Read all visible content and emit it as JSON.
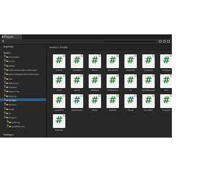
{
  "window": {
    "tab_label": "Project",
    "toolbar": {
      "add_label": "+"
    }
  },
  "tree": {
    "favorites_label": "Favorites",
    "assets_label": "Assets",
    "items": [
      "Animation",
      "Audio",
      "Editor",
      "EditorDependencyManager",
      "ExternalDependencyManager",
      "IAP",
      "Materials",
      "Prefabs",
      "Resources",
      "Scenes",
      "Scripts",
      "Sprites",
      "Tests",
      "UI",
      "Plugins",
      "Settings",
      "TextMesh Pro"
    ],
    "selected_item": "Scripts",
    "packages_label": "Packages"
  },
  "content": {
    "breadcrumb": "Assets > Scripts",
    "assets": [
      "Admob",
      "AudioMan",
      "Bonus",
      "BonusFood",
      "Character",
      "Comment",
      "Configure",
      "Cube",
      "Dance",
      "Database",
      "DoubleDrop",
      "FX",
      "GameManager",
      "Grid",
      "LevelFinal",
      "Leaderboard",
      "Player",
      "Parallax",
      "Popup",
      "ScoreMan",
      "Snapshot",
      "Spawner"
    ]
  }
}
